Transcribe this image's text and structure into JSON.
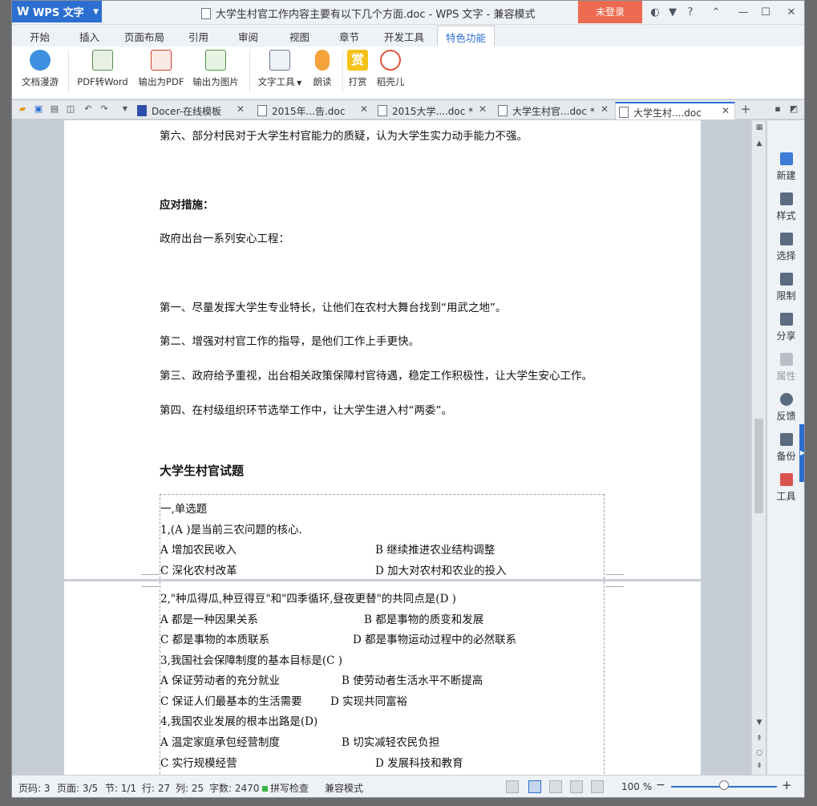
{
  "app": {
    "name": "WPS 文字",
    "title": "大学生村官工作内容主要有以下几个方面.doc - WPS 文字 - 兼容模式",
    "login": "未登录",
    "help": "?"
  },
  "menu": {
    "tabs": [
      "开始",
      "插入",
      "页面布局",
      "引用",
      "审阅",
      "视图",
      "章节",
      "开发工具",
      "特色功能"
    ],
    "active_index": 8
  },
  "ribbon": {
    "buttons": [
      "文档漫游",
      "PDF转Word",
      "输出为PDF",
      "输出为图片",
      "文字工具",
      "朗读",
      "打赏",
      "稻壳儿"
    ],
    "reward_glyph": "赏"
  },
  "tabs": {
    "items": [
      {
        "label": "Docer-在线模板"
      },
      {
        "label": "2015年...告.doc"
      },
      {
        "label": "2015大学....doc *"
      },
      {
        "label": "大学生村官...doc *"
      },
      {
        "label": "大学生村....doc"
      }
    ],
    "add": "+"
  },
  "document": {
    "page1": [
      {
        "text": "第六、部分村民对于大学生村官能力的质疑，认为大学生实力动手能力不强。",
        "style": "normal"
      },
      {
        "text": "应对措施：",
        "style": "bold"
      },
      {
        "text": "政府出台一系列安心工程：",
        "style": "normal"
      },
      {
        "text": "第一、尽量发挥大学生专业特长，让他们在农村大舞台找到“用武之地”。",
        "style": "normal"
      },
      {
        "text": "第二、增强对村官工作的指导，是他们工作上手更快。",
        "style": "normal"
      },
      {
        "text": "第三、政府给予重视，出台相关政策保障村官待遇，稳定工作积极性，让大学生安心工作。",
        "style": "normal"
      },
      {
        "text": "第四、在村级组织环节选举工作中，让大学生进入村“两委”。",
        "style": "normal"
      },
      {
        "text": "大学生村官试题",
        "style": "heading"
      }
    ],
    "quiz_page1": [
      {
        "text": "一,单选题"
      },
      {
        "text": "1,(A )是当前三农问题的核心."
      },
      {
        "a": "A 增加农民收入",
        "b": "B 继续推进农业结构调整"
      },
      {
        "a": "C 深化农村改革",
        "b": "D 加大对农村和农业的投入"
      }
    ],
    "quiz_page2": [
      {
        "text": "2,\"种瓜得瓜,种豆得豆\"和\"四季循环,昼夜更替\"的共同点是(D )"
      },
      {
        "a": "A 都是一种因果关系",
        "b": "B 都是事物的质变和发展"
      },
      {
        "a": "C 都是事物的本质联系",
        "b": "D 都是事物运动过程中的必然联系"
      },
      {
        "text": "3,我国社会保障制度的基本目标是(C )"
      },
      {
        "a": "A 保证劳动者的充分就业",
        "b": "B 使劳动者生活水平不断提高"
      },
      {
        "a": "C 保证人们最基本的生活需要",
        "b": "D 实现共同富裕"
      },
      {
        "text": "4,我国农业发展的根本出路是(D)"
      },
      {
        "a": "A 温定家庭承包经营制度",
        "b": "B 切实减轻农民负担"
      },
      {
        "a": "C 实行规模经营",
        "b": "D 发展科技和教育"
      }
    ]
  },
  "sidebar": {
    "items": [
      {
        "label": "新建",
        "icon": "new-doc-icon",
        "enabled": true
      },
      {
        "label": "样式",
        "icon": "style-icon",
        "enabled": true
      },
      {
        "label": "选择",
        "icon": "select-icon",
        "enabled": true
      },
      {
        "label": "限制",
        "icon": "restrict-icon",
        "enabled": true
      },
      {
        "label": "分享",
        "icon": "share-icon",
        "enabled": true
      },
      {
        "label": "属性",
        "icon": "properties-icon",
        "enabled": false
      },
      {
        "label": "反馈",
        "icon": "feedback-icon",
        "enabled": true
      },
      {
        "label": "备份",
        "icon": "backup-icon",
        "enabled": true
      },
      {
        "label": "工具",
        "icon": "toolbox-icon",
        "enabled": true
      }
    ]
  },
  "status": {
    "page_num": "页码: 3",
    "pages": "页面: 3/5",
    "section": "节: 1/1",
    "row": "行: 27",
    "col": "列: 25",
    "words": "字数: 2470",
    "spell": "拼写检查",
    "compat": "兼容模式",
    "zoom": "100 %",
    "minus": "−",
    "plus": "+"
  },
  "colors": {
    "accent": "#2c6fd1",
    "login": "#ed6b50"
  }
}
